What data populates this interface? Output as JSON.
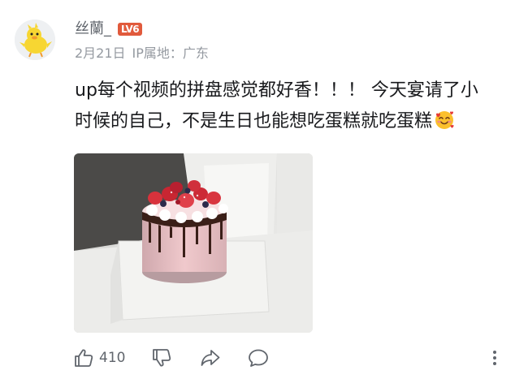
{
  "comment": {
    "username": "丝蘭_",
    "level": "LV6",
    "date": "2月21日",
    "ip_location": "IP属地：广东",
    "content_lines": [
      "up每个视频的拼盘感觉都好香！！！ 今天宴请了小",
      "时候的自己，不是生日也能想吃蛋糕就吃蛋糕"
    ],
    "content_emoji": "smiling-face-with-hearts-icon",
    "image": "strawberry-cake-photo",
    "like_count": "410"
  },
  "colors": {
    "username": "#61666d",
    "meta": "#9499a0",
    "text": "#18191c",
    "level_badge": "#e15a3c",
    "icon": "#61666d"
  }
}
